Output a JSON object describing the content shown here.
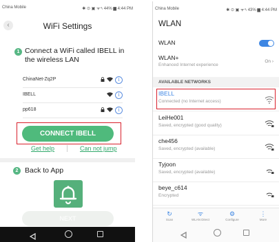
{
  "left": {
    "status_bar": {
      "carrier": "China Mobile",
      "status": "✱ ⊙ ▣ ᯤ⁴ₗ 44% ▆ 4:44 PM"
    },
    "back_glyph": "‹",
    "title": "WiFi Settings",
    "step1": {
      "number": "1",
      "text": "Connect a WiFi called IBELL in the wireless LAN"
    },
    "networks": [
      {
        "name": "ChinaNet-Zq2P",
        "lock": "🔒",
        "wifi": "📶",
        "info": "i"
      },
      {
        "name": "IBELL",
        "lock": "",
        "wifi": "📶",
        "info": "i"
      },
      {
        "name": "pp618",
        "lock": "🔒",
        "wifi": "📶",
        "info": "i"
      }
    ],
    "connect_label": "CONNECT IBELL",
    "get_help": "Get help",
    "not_jump": "Can not jump",
    "step2": {
      "number": "2",
      "text": "Back to App"
    },
    "next_label": "NEXT",
    "accent": "#4fba7c"
  },
  "right": {
    "status_bar": {
      "carrier": "China Mobile",
      "status": "✱ ⊙ ▣ ᯤ⁴ₗ 43% ▆ 4:44 PM"
    },
    "title": "WLAN",
    "wlan_label": "WLAN",
    "wlan_plus": {
      "label": "WLAN+",
      "sub": "Enhanced Internet experience",
      "value": "On ›"
    },
    "section": "AVAILABLE NETWORKS",
    "networks": [
      {
        "name": "IBELL",
        "status": "Connected (no Internet access)"
      },
      {
        "name": "LeiHe001",
        "status": "Saved, encrypted (good quality)"
      },
      {
        "name": "che456",
        "status": "Saved, encrypted (available)"
      },
      {
        "name": "Tyjoon",
        "status": "Saved, encrypted (available)"
      },
      {
        "name": "beye_c614",
        "status": "Encrypted"
      }
    ],
    "tabs": [
      {
        "icon": "↻",
        "label": "Scan"
      },
      {
        "icon": "ᯤ",
        "label": "WLAN Direct"
      },
      {
        "icon": "⚙",
        "label": "Configure"
      },
      {
        "icon": "⋮",
        "label": "More"
      }
    ],
    "accent": "#3d86e3"
  }
}
